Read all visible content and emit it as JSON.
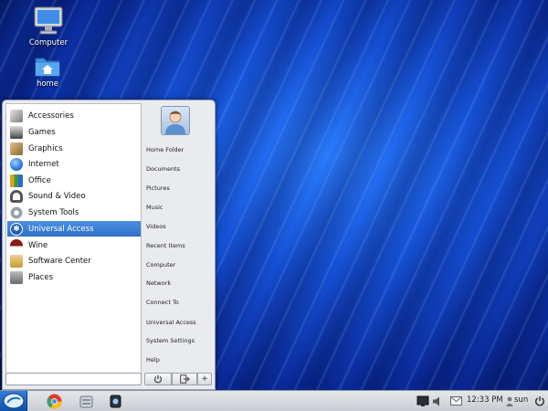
{
  "desktop": {
    "icons": [
      {
        "label": "Computer",
        "icon": "computer-icon"
      },
      {
        "label": "home",
        "icon": "home-folder-icon"
      }
    ]
  },
  "menu": {
    "categories": [
      {
        "label": "Accessories",
        "icon": "accessories-icon",
        "color": "#7a7a7a"
      },
      {
        "label": "Games",
        "icon": "games-icon",
        "color": "#444444"
      },
      {
        "label": "Graphics",
        "icon": "graphics-icon",
        "color": "#8a6a3a"
      },
      {
        "label": "Internet",
        "icon": "internet-icon",
        "color": "#2a7ad8"
      },
      {
        "label": "Office",
        "icon": "office-icon",
        "color": "#3a9a3a"
      },
      {
        "label": "Sound & Video",
        "icon": "headphones-icon",
        "color": "#555555"
      },
      {
        "label": "System Tools",
        "icon": "system-tools-icon",
        "color": "#9aa0a8"
      },
      {
        "label": "Universal Access",
        "icon": "universal-access-icon",
        "color": "#1f5fb5"
      },
      {
        "label": "Wine",
        "icon": "wine-icon",
        "color": "#8a1a1a"
      },
      {
        "label": "Software Center",
        "icon": "software-center-icon",
        "color": "#c89a3a"
      },
      {
        "label": "Places",
        "icon": "places-icon",
        "color": "#6a6a6a"
      }
    ],
    "selected_index": 7,
    "search_value": "",
    "places": [
      "Home Folder",
      "Documents",
      "Pictures",
      "Music",
      "Videos",
      "Recent Items",
      "Computer",
      "Network",
      "Connect To",
      "Universal Access",
      "System Settings",
      "Help"
    ],
    "buttons": {
      "power_icon": "power-icon",
      "logout_icon": "logout-icon",
      "add_label": "+"
    }
  },
  "taskbar": {
    "clock": "12:33 PM",
    "username": "sun",
    "accent": "#1a6fd0"
  }
}
